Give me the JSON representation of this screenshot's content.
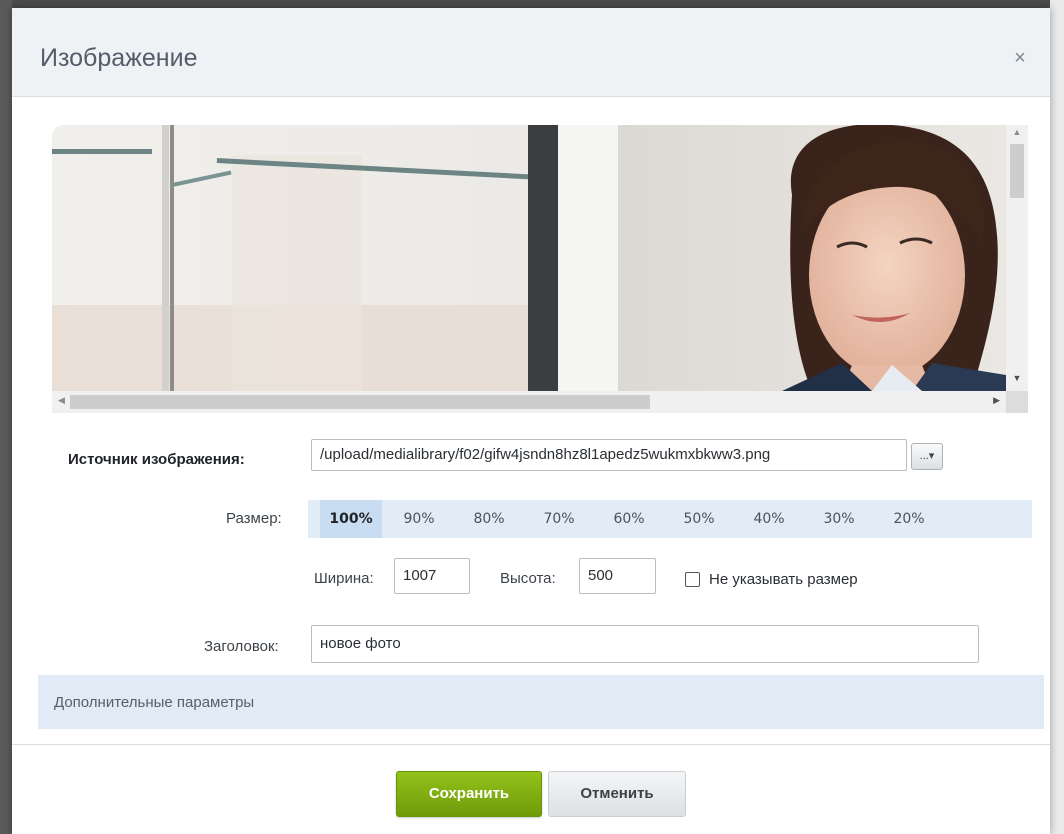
{
  "dialog": {
    "title": "Изображение",
    "close_glyph": "×"
  },
  "source": {
    "label": "Источник изображения:",
    "value": "/upload/medialibrary/f02/gifw4jsndn8hz8l1apedz5wukmxbkww3.png",
    "browse_label": "...▾"
  },
  "size": {
    "label": "Размер:",
    "options": [
      "100%",
      "90%",
      "80%",
      "70%",
      "60%",
      "50%",
      "40%",
      "30%",
      "20%"
    ],
    "selected": "100%"
  },
  "dimensions": {
    "width_label": "Ширина:",
    "width_value": "1007",
    "height_label": "Высота:",
    "height_value": "500",
    "no_size_label": "Не указывать размер",
    "no_size_checked": false
  },
  "caption": {
    "label": "Заголовок:",
    "value": "новое фото"
  },
  "advanced": {
    "label": "Дополнительные параметры"
  },
  "footer": {
    "save_label": "Сохранить",
    "cancel_label": "Отменить"
  },
  "colors": {
    "save_button": "#7cab0f",
    "size_bar": "#e1ecf7",
    "advanced_bar": "#e1ebf5",
    "title_bar": "#eef2f4"
  },
  "icons": {
    "close": "close-icon",
    "scroll_up": "scroll-up-arrow-icon",
    "scroll_down": "scroll-down-arrow-icon",
    "scroll_left": "scroll-left-arrow-icon",
    "scroll_right": "scroll-right-arrow-icon"
  }
}
